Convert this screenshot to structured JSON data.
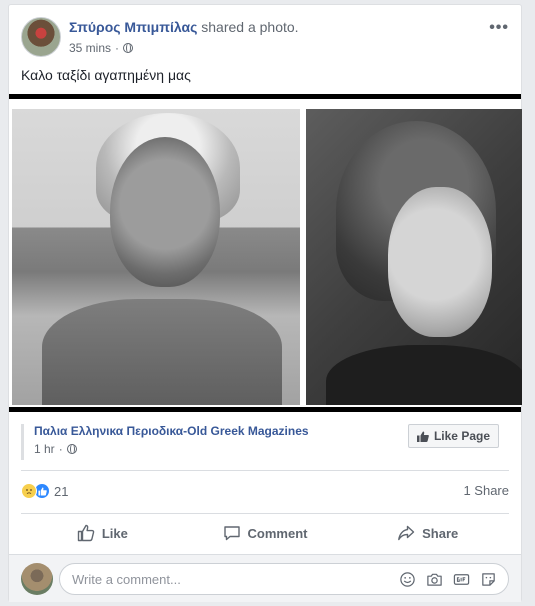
{
  "post": {
    "author": "Σπύρος Μπιμπίλας",
    "action": "shared a photo.",
    "time": "35 mins",
    "separator": "·",
    "text": "Καλο ταξίδι αγαπημένη μας",
    "more_label": "•••"
  },
  "shared_page": {
    "name": "Παλια Ελληνικα Περιοδικα-Old Greek Magazines",
    "time": "1 hr",
    "separator": "·",
    "like_page_label": "Like Page"
  },
  "stats": {
    "reaction_count": "21",
    "shares": "1 Share"
  },
  "actions": {
    "like": "Like",
    "comment": "Comment",
    "share": "Share"
  },
  "comment_box": {
    "placeholder": "Write a comment..."
  },
  "colors": {
    "author": "#385898",
    "like_blue": "#2d88ff",
    "sad_yellow": "#f7cf4d"
  },
  "icons": [
    "globe-icon",
    "more-icon",
    "thumbs-up-icon",
    "comment-icon",
    "share-icon",
    "emoji-icon",
    "camera-icon",
    "gif-icon",
    "sticker-icon"
  ]
}
